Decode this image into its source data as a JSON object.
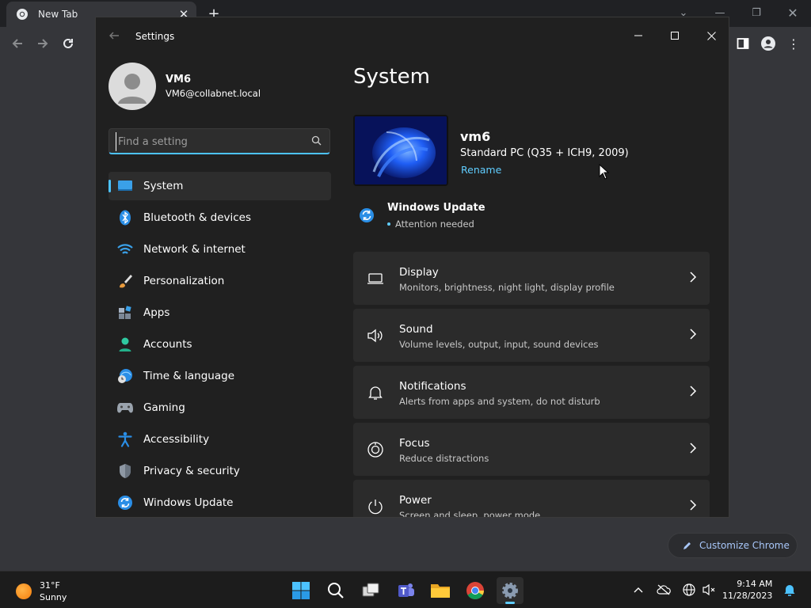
{
  "chrome": {
    "tab_title": "New Tab",
    "new_tab_symbol": "+",
    "customize_label": "Customize Chrome"
  },
  "settings": {
    "title": "Settings",
    "account": {
      "name": "VM6",
      "email": "VM6@collabnet.local"
    },
    "search_placeholder": "Find a setting",
    "nav": [
      {
        "label": "System",
        "icon": "system-icon",
        "active": true
      },
      {
        "label": "Bluetooth & devices",
        "icon": "bluetooth-icon"
      },
      {
        "label": "Network & internet",
        "icon": "wifi-icon"
      },
      {
        "label": "Personalization",
        "icon": "brush-icon"
      },
      {
        "label": "Apps",
        "icon": "apps-icon"
      },
      {
        "label": "Accounts",
        "icon": "person-icon"
      },
      {
        "label": "Time & language",
        "icon": "globe-clock-icon"
      },
      {
        "label": "Gaming",
        "icon": "gamepad-icon"
      },
      {
        "label": "Accessibility",
        "icon": "accessibility-icon"
      },
      {
        "label": "Privacy & security",
        "icon": "shield-icon"
      },
      {
        "label": "Windows Update",
        "icon": "update-icon"
      }
    ],
    "page_title": "System",
    "device": {
      "name": "vm6",
      "model": "Standard PC (Q35 + ICH9, 2009)",
      "rename": "Rename"
    },
    "windows_update": {
      "title": "Windows Update",
      "status": "Attention needed"
    },
    "cards": [
      {
        "title": "Display",
        "subtitle": "Monitors, brightness, night light, display profile",
        "icon": "monitor-icon"
      },
      {
        "title": "Sound",
        "subtitle": "Volume levels, output, input, sound devices",
        "icon": "speaker-icon"
      },
      {
        "title": "Notifications",
        "subtitle": "Alerts from apps and system, do not disturb",
        "icon": "bell-icon"
      },
      {
        "title": "Focus",
        "subtitle": "Reduce distractions",
        "icon": "focus-icon"
      },
      {
        "title": "Power",
        "subtitle": "Screen and sleep, power mode",
        "icon": "power-icon"
      }
    ]
  },
  "taskbar": {
    "weather": {
      "temp": "31°F",
      "condition": "Sunny"
    },
    "time": "9:14 AM",
    "date": "11/28/2023"
  },
  "colors": {
    "accent": "#4cc2ff",
    "link": "#60cdff",
    "window_bg": "#202020",
    "card_bg": "#2b2b2b"
  }
}
